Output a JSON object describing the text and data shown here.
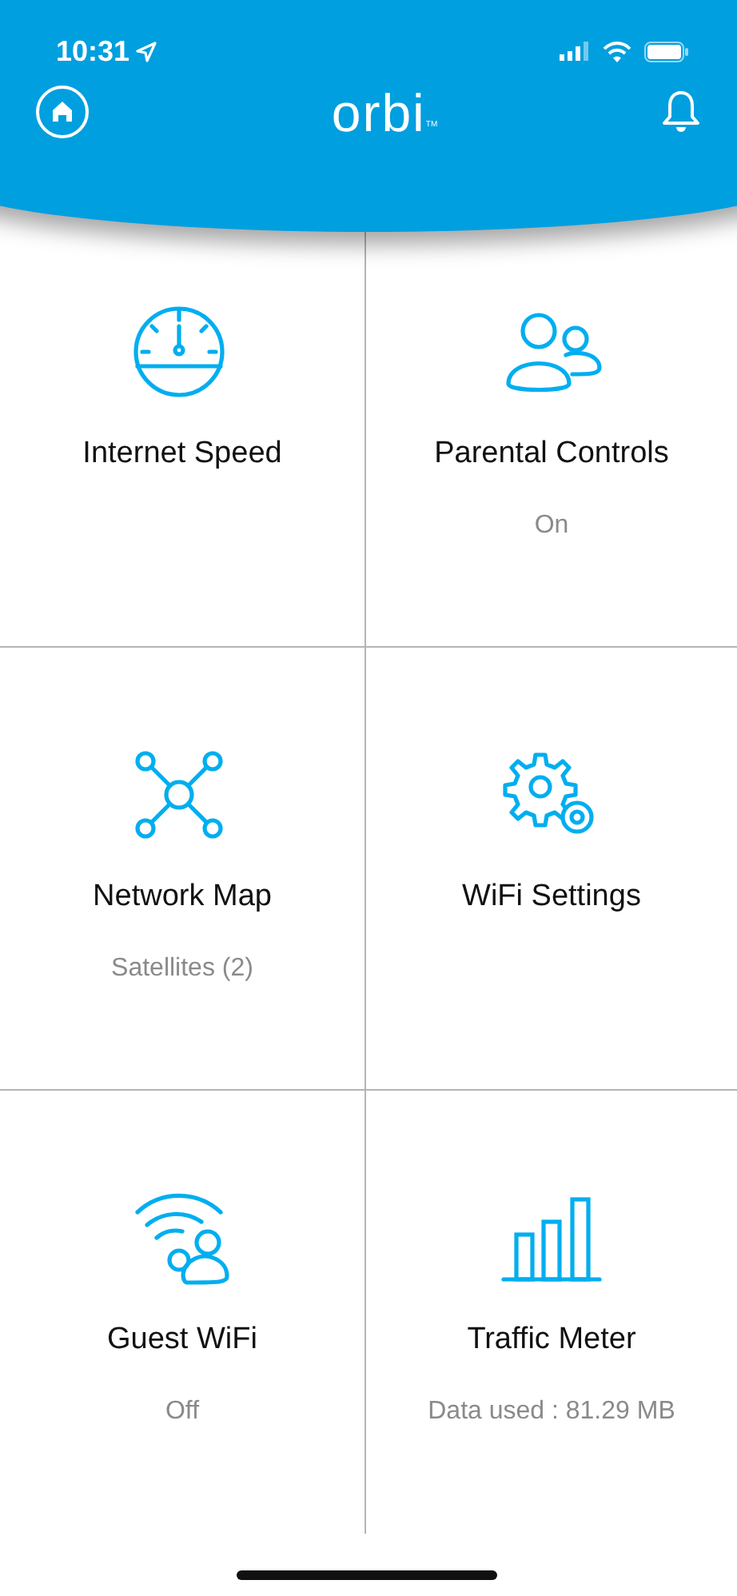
{
  "status_bar": {
    "time": "10:31"
  },
  "header": {
    "logo": "orbi",
    "trademark": "TM"
  },
  "tiles": [
    {
      "title": "Internet Speed"
    },
    {
      "title": "Parental Controls",
      "subtitle": "On"
    },
    {
      "title": "Network Map",
      "subtitle": "Satellites (2)"
    },
    {
      "title": "WiFi Settings"
    },
    {
      "title": "Guest WiFi",
      "subtitle": "Off"
    },
    {
      "title": "Traffic Meter",
      "subtitle": "Data used : 81.29 MB"
    }
  ]
}
